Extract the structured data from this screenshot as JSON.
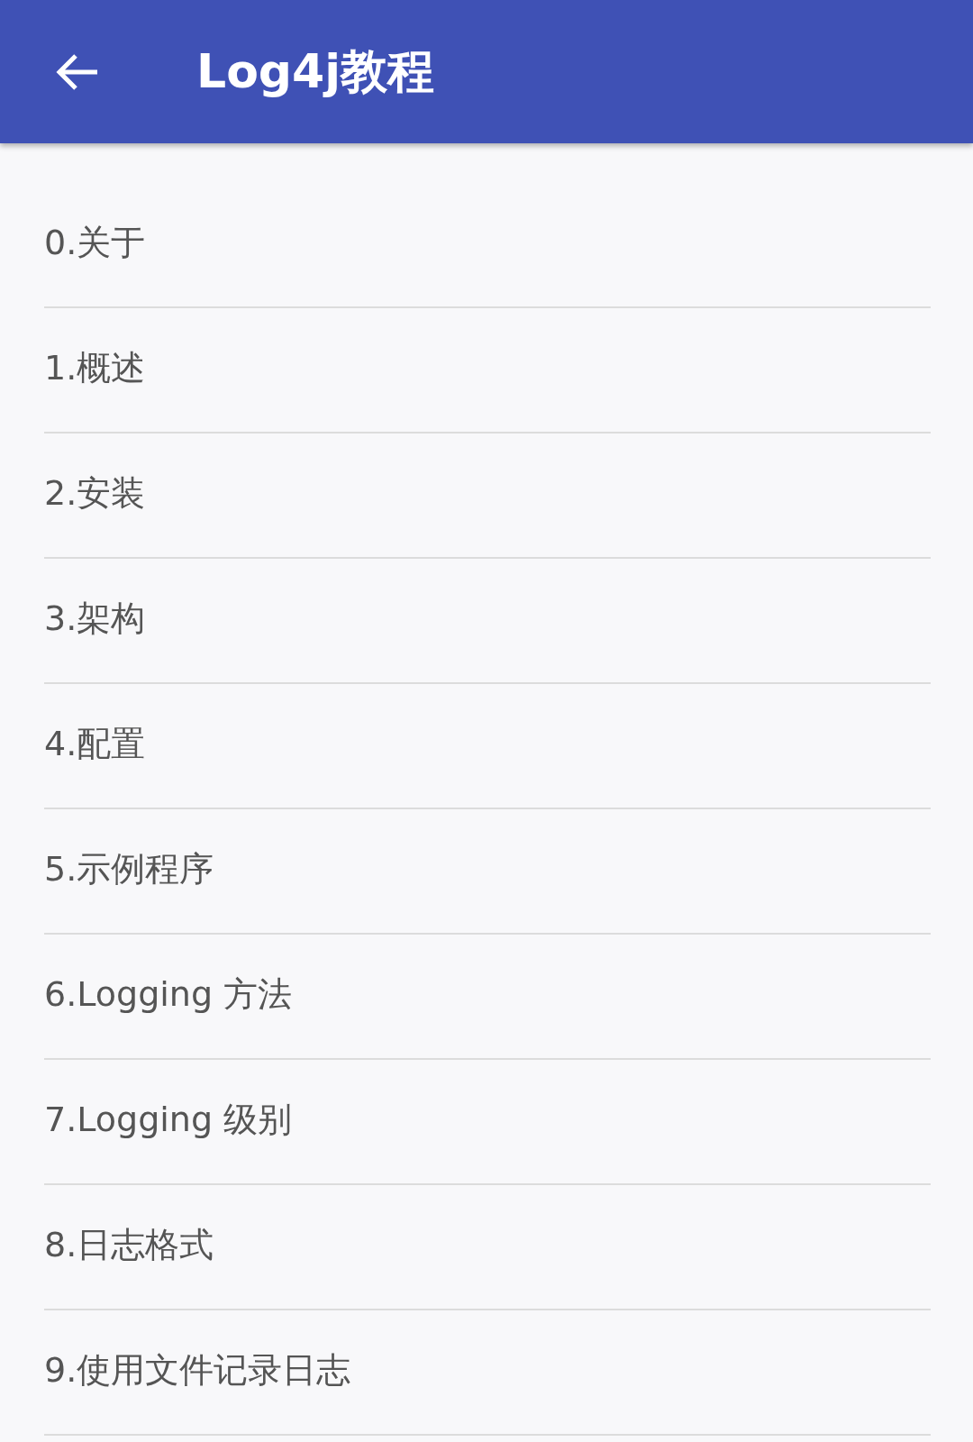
{
  "app_bar": {
    "title": "Log4j教程"
  },
  "items": [
    {
      "label": "0.关于"
    },
    {
      "label": "1.概述"
    },
    {
      "label": "2.安装"
    },
    {
      "label": "3.架构"
    },
    {
      "label": "4.配置"
    },
    {
      "label": "5.示例程序"
    },
    {
      "label": "6.Logging 方法"
    },
    {
      "label": "7.Logging 级别"
    },
    {
      "label": "8.日志格式"
    },
    {
      "label": "9.使用文件记录日志"
    }
  ]
}
